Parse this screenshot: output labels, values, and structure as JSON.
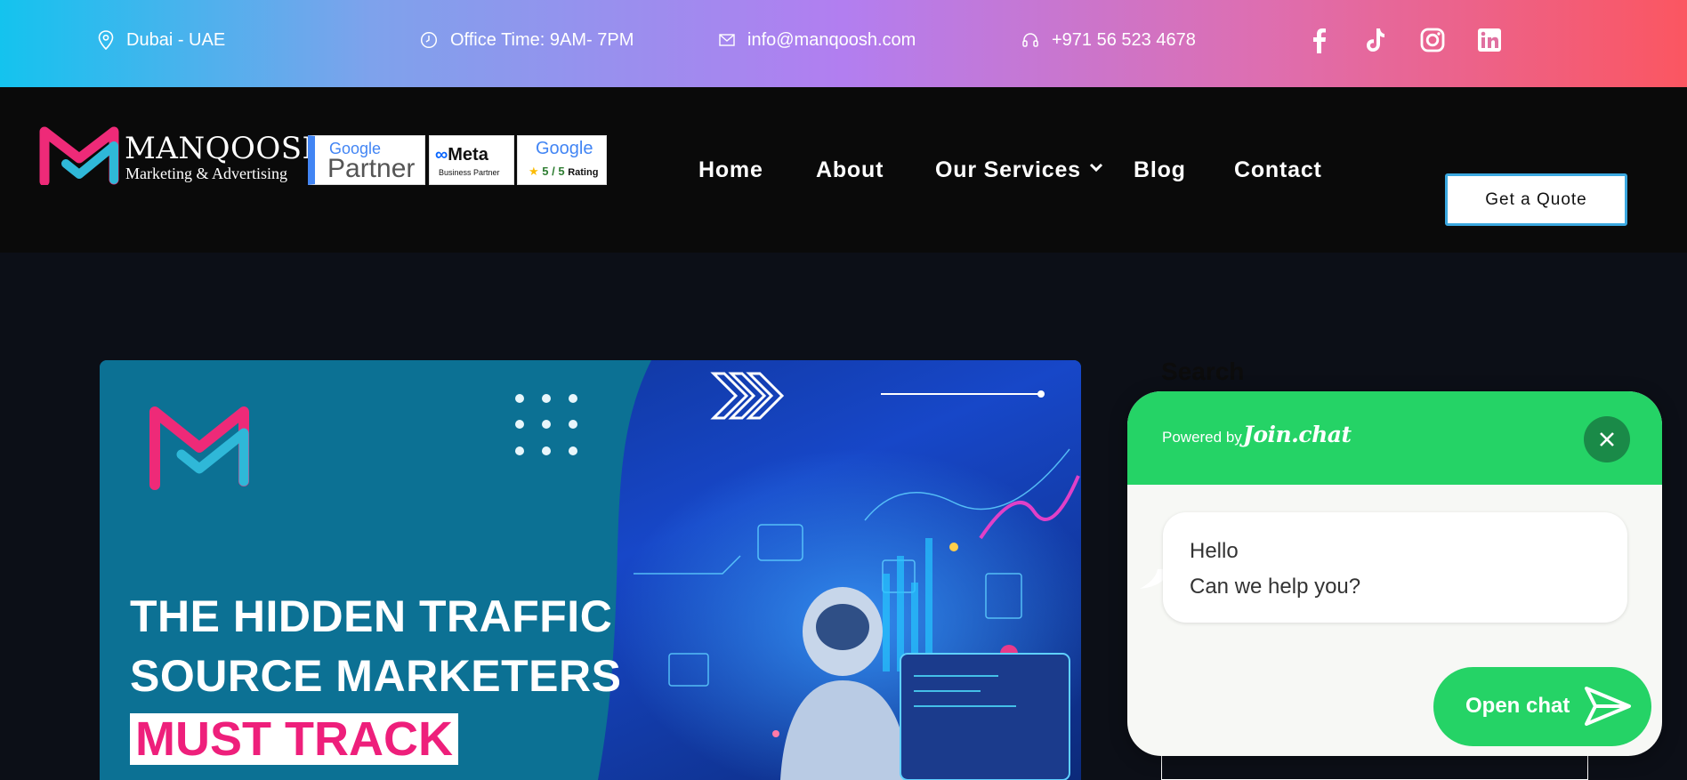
{
  "topbar": {
    "location": "Dubai - UAE",
    "office_time": "Office Time: 9AM- 7PM",
    "email": "info@manqoosh.com",
    "phone": "+971 56 523 4678",
    "socials": [
      "facebook-icon",
      "tiktok-icon",
      "instagram-icon",
      "linkedin-icon"
    ]
  },
  "header": {
    "brand_name": "MANQOOSH",
    "brand_tagline": "Marketing & Advertising",
    "badges": {
      "google_partner_top": "Google",
      "google_partner_bottom": "Partner",
      "meta_title": "Meta",
      "meta_sub": "Business Partner",
      "rating_top": "Google",
      "rating_value": "5 / 5",
      "rating_label": "Rating"
    },
    "nav": [
      "Home",
      "About",
      "Our Services",
      "Blog",
      "Contact"
    ],
    "cta": "Get a Quote"
  },
  "hero": {
    "line1": "THE HIDDEN TRAFFIC",
    "line2": "SOURCE MARKETERS",
    "highlight": "MUST TRACK"
  },
  "sidebar": {
    "search_label": "Search"
  },
  "chat": {
    "powered_by": "Powered by",
    "brand": "Join.chat",
    "message_line1": "Hello",
    "message_line2": "Can we help you?",
    "open_label": "Open chat"
  },
  "colors": {
    "accent_pink": "#ee1f7b",
    "whatsapp_green": "#25d366",
    "teal": "#0b6b8e",
    "cta_border": "#3ba8e0"
  }
}
